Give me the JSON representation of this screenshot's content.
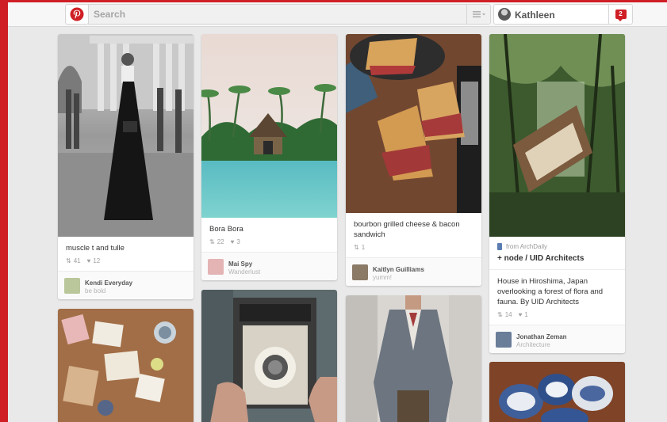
{
  "colors": {
    "brand_red": "#cf1f25",
    "background": "#e9e9e9"
  },
  "header": {
    "logo_icon": "pinterest-logo",
    "search": {
      "placeholder": "Search",
      "menu_icon": "list-menu-icon"
    },
    "profile": {
      "name": "Kathleen",
      "notification_count": "2"
    }
  },
  "pins": [
    {
      "description": "muscle t and tulle",
      "repins": "41",
      "likes": "12",
      "via": {
        "name": "Kendi Everyday",
        "board": "be bold"
      }
    },
    {
      "description": "Bora Bora",
      "repins": "22",
      "likes": "3",
      "via": {
        "name": "Mai Spy",
        "board": "Wanderlust"
      }
    },
    {
      "description": "bourbon grilled cheese & bacon sandwich",
      "repins": "1",
      "via": {
        "name": "Kaitlyn Guilliams",
        "board": "yumm!"
      }
    },
    {
      "source_label": "from ArchDaily",
      "source_title": "+ node / UID Architects",
      "description": "House in Hiroshima, Japan overlooking a forest of flora and fauna. By UID Architects",
      "repins": "14",
      "likes": "1",
      "via": {
        "name": "Jonathan Zeman",
        "board": "Architecture"
      }
    },
    {
      "subject": "vintage table with cups"
    },
    {
      "subject": "vintage camera"
    },
    {
      "subject": "man in grey blazer"
    },
    {
      "subject": "blue and white bowls"
    }
  ]
}
